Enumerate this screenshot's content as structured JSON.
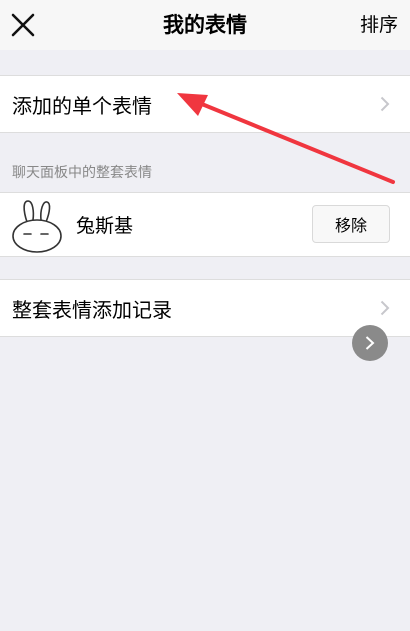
{
  "nav": {
    "title": "我的表情",
    "sort_label": "排序",
    "close_icon": "close-icon"
  },
  "single_stickers": {
    "label": "添加的单个表情"
  },
  "section": {
    "header": "聊天面板中的整套表情"
  },
  "sticker_sets": [
    {
      "name": "兔斯基",
      "remove_label": "移除"
    }
  ],
  "history": {
    "label": "整套表情添加记录"
  },
  "colors": {
    "background": "#efeff4",
    "annotation_arrow": "#f0363f"
  }
}
